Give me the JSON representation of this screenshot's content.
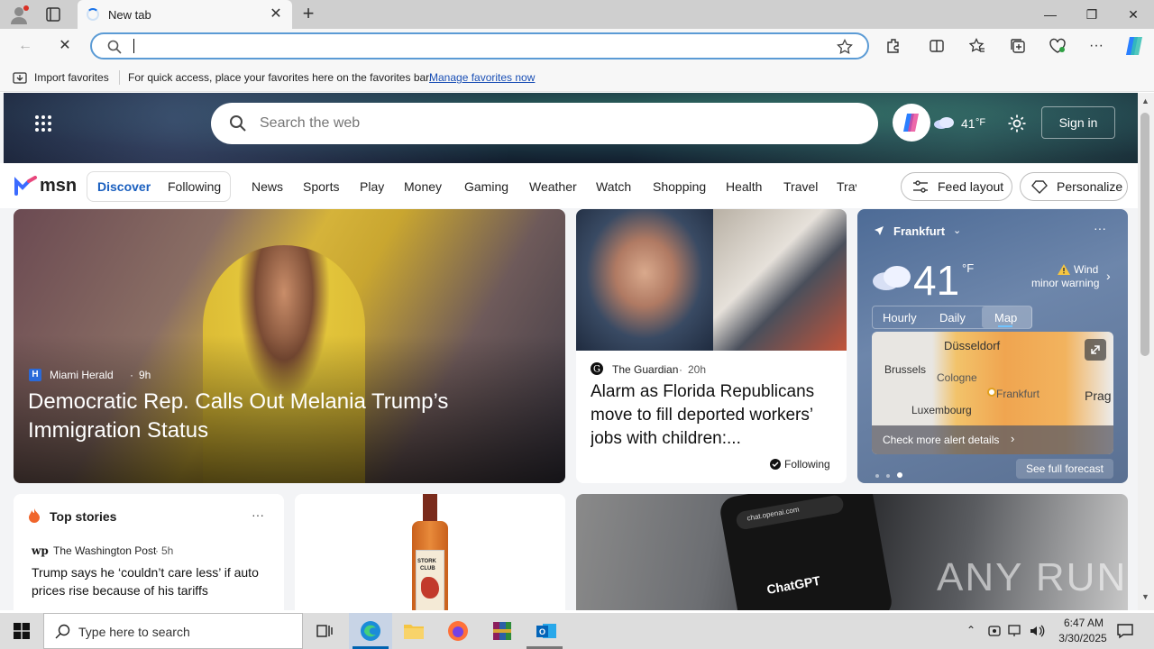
{
  "browser": {
    "tab_title": "New tab",
    "address_placeholder": "",
    "favorites_import": "Import favorites",
    "favorites_hint": "For quick access, place your favorites here on the favorites bar.",
    "favorites_link": "Manage favorites now"
  },
  "msn_header": {
    "search_placeholder": "Search the web",
    "weather_temp": "41",
    "weather_unit": "°F",
    "sign_in": "Sign in"
  },
  "msn_nav": {
    "logo": "msn",
    "tabs": [
      "Discover",
      "Following"
    ],
    "links": [
      "News",
      "Sports",
      "Play",
      "Money",
      "Gaming",
      "Weather",
      "Watch",
      "Shopping",
      "Health",
      "Travel",
      "Trav"
    ],
    "feed_layout": "Feed layout",
    "personalize": "Personalize"
  },
  "hero": {
    "source": "Miami Herald",
    "age": "9h",
    "headline": "Democratic Rep. Calls Out Melania Trump’s Immigration Status"
  },
  "article2": {
    "source": "The Guardian",
    "age": "20h",
    "headline": "Alarm as Florida Republicans move to fill deported workers’ jobs with children:...",
    "following": "Following"
  },
  "weather": {
    "city": "Frankfurt",
    "temp": "41",
    "unit": "°F",
    "alert_title": "Wind",
    "alert_sub": "minor warning",
    "tabs": [
      "Hourly",
      "Daily",
      "Map"
    ],
    "map_labels": [
      "Düsseldorf",
      "Brussels",
      "Cologne",
      "Frankfurt",
      "Luxembourg",
      "Prag"
    ],
    "alert_link": "Check more alert details",
    "forecast_link": "See full forecast"
  },
  "top_stories": {
    "title": "Top stories",
    "source": "The Washington Post",
    "age": "5h",
    "headline": "Trump says he ‘couldn’t care less’ if auto prices rise because of his tariffs"
  },
  "product": {
    "label_top": "STORK",
    "label_bottom": "CLUB"
  },
  "chatgpt": {
    "url": "chat.openai.com",
    "label": "ChatGPT",
    "watermark": "ANY RUN"
  },
  "taskbar": {
    "search_placeholder": "Type here to search",
    "time": "6:47 AM",
    "date": "3/30/2025"
  }
}
